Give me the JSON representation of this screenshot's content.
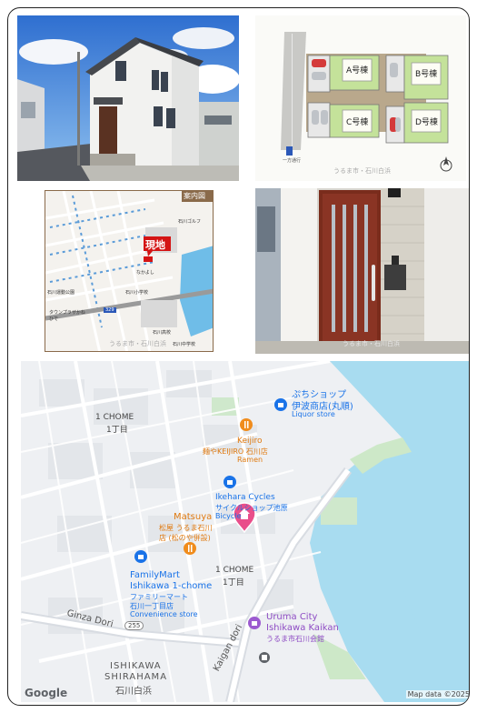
{
  "site_plan": {
    "lots": [
      "A号棟",
      "B号棟",
      "C号棟",
      "D号棟"
    ],
    "road_label": "一方通行",
    "watermark": "うるま市・石川白浜"
  },
  "guide_map": {
    "title": "案内図",
    "site_label": "現地",
    "places": [
      "石川ゴルフ",
      "石川小学校",
      "なかよし",
      "タウンプラザかねひで",
      "石川高校",
      "石川中学校",
      "石川運動公園"
    ],
    "route": "329",
    "watermark": "うるま市・石川白浜"
  },
  "door_photo": {
    "watermark": "うるま市・石川白浜"
  },
  "map": {
    "labels": {
      "chome_1_top": "1 CHOME",
      "chome_1_top_jp": "1丁目",
      "puchi_shop": "ぷちショップ",
      "puchi_shop_jp": "伊波商店(丸順)",
      "puchi_shop_cat": "Liquor store",
      "keijiro": "Keijiro",
      "keijiro_jp": "麺やKEIJIRO 石川店",
      "keijiro_cat": "Ramen",
      "ikehara": "Ikehara Cycles",
      "ikehara_jp": "サイクルショップ池原",
      "ikehara_cat": "Bicycle",
      "matsuya": "Matsuya",
      "matsuya_jp1": "松屋 うるま石川",
      "matsuya_jp2": "店 (松のや併設)",
      "chome_1_mid": "1 CHOME",
      "chome_1_mid_jp": "1丁目",
      "familymart": "FamilyMart",
      "familymart2": "Ishikawa 1-chome",
      "familymart_jp1": "ファミリーマート",
      "familymart_jp2": "石川一丁目店",
      "familymart_cat": "Convenience store",
      "route_255": "255",
      "ginza": "Ginza Dori",
      "kaigan": "Kaigan dori",
      "uruma1": "Uruma City",
      "uruma2": "Ishikawa Kaikan",
      "uruma_jp": "うるま市石川会館",
      "shirahama1": "ISHIKAWA",
      "shirahama2": "SHIRAHAMA",
      "shirahama_jp": "石川白浜"
    },
    "logo": "Google",
    "attribution": "Map data ©2025"
  },
  "colors": {
    "water": "#a8dcf0",
    "land": "#eef0f3",
    "pin": "#e94e8a",
    "poi_blue": "#1a73e8",
    "poi_orange": "#f08c1c",
    "poi_purple": "#9c5ad0"
  }
}
